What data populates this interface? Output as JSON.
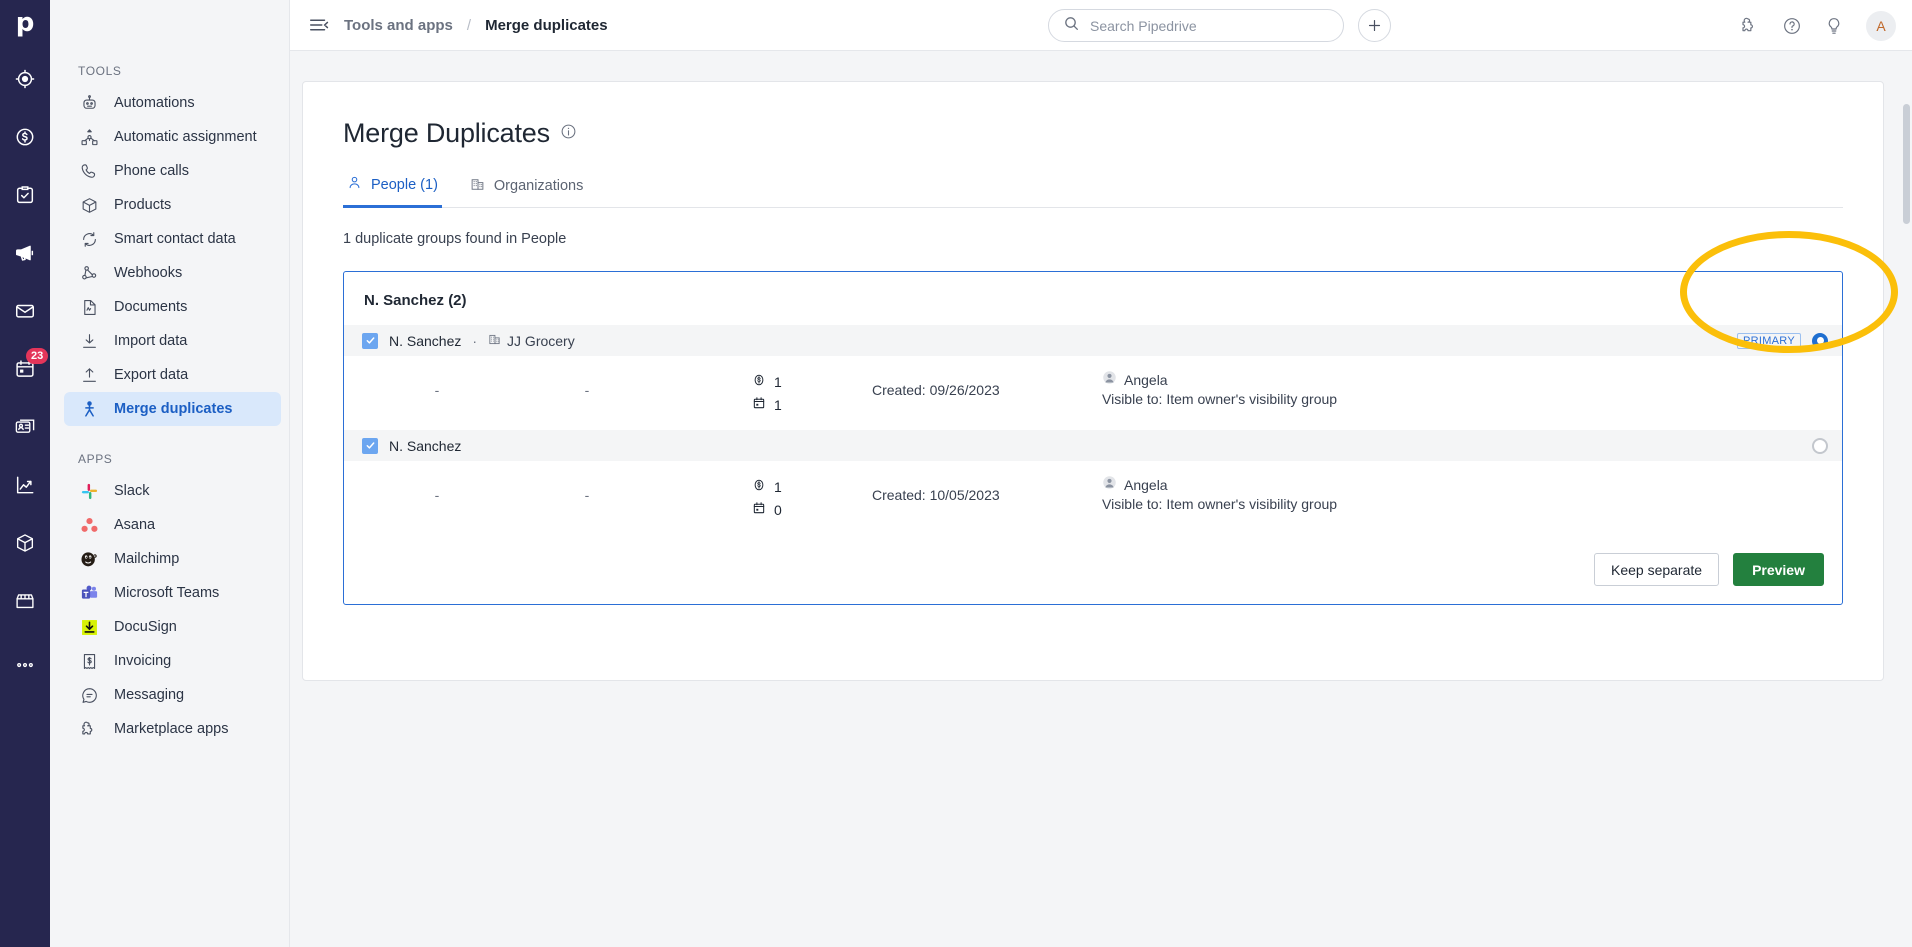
{
  "brand": {
    "logo_letter": "p",
    "accent": "#2b6fd6",
    "rail_bg": "#26264f",
    "highlight_color": "#fbbf0a"
  },
  "rail": {
    "items": [
      {
        "name": "leads-icon",
        "label": "Leads"
      },
      {
        "name": "deals-icon",
        "label": "Deals"
      },
      {
        "name": "activities-icon",
        "label": "Activities"
      },
      {
        "name": "campaigns-icon",
        "label": "Campaigns"
      },
      {
        "name": "mail-icon",
        "label": "Mail"
      },
      {
        "name": "calendar-icon",
        "label": "Calendar",
        "badge": "23"
      },
      {
        "name": "contacts-icon",
        "label": "Contacts"
      },
      {
        "name": "insights-icon",
        "label": "Insights"
      },
      {
        "name": "products-icon",
        "label": "Products"
      },
      {
        "name": "marketplace-icon",
        "label": "Marketplace"
      },
      {
        "name": "more-icon",
        "label": "More"
      }
    ]
  },
  "topbar": {
    "menu_icon": "hamburger-icon",
    "breadcrumb_parent": "Tools and apps",
    "breadcrumb_sep": "/",
    "breadcrumb_current": "Merge duplicates",
    "search_placeholder": "Search Pipedrive",
    "search_value": "",
    "add_label": "+",
    "icons": [
      {
        "name": "apps-puzzle-icon"
      },
      {
        "name": "help-icon"
      },
      {
        "name": "whats-new-bulb-icon"
      }
    ],
    "avatar_initial": "A"
  },
  "sidebar": {
    "tools_header": "TOOLS",
    "tools": [
      {
        "label": "Automations",
        "icon": "automations-icon"
      },
      {
        "label": "Automatic assignment",
        "icon": "automatic-assignment-icon"
      },
      {
        "label": "Phone calls",
        "icon": "phone-icon"
      },
      {
        "label": "Products",
        "icon": "products-box-icon"
      },
      {
        "label": "Smart contact data",
        "icon": "smart-contact-data-icon"
      },
      {
        "label": "Webhooks",
        "icon": "webhooks-icon"
      },
      {
        "label": "Documents",
        "icon": "documents-icon"
      },
      {
        "label": "Import data",
        "icon": "import-data-icon"
      },
      {
        "label": "Export data",
        "icon": "export-data-icon"
      },
      {
        "label": "Merge duplicates",
        "icon": "merge-duplicates-icon",
        "active": true
      }
    ],
    "apps_header": "APPS",
    "apps": [
      {
        "label": "Slack",
        "icon": "slack-icon"
      },
      {
        "label": "Asana",
        "icon": "asana-icon"
      },
      {
        "label": "Mailchimp",
        "icon": "mailchimp-icon"
      },
      {
        "label": "Microsoft Teams",
        "icon": "microsoft-teams-icon"
      },
      {
        "label": "DocuSign",
        "icon": "docusign-icon"
      },
      {
        "label": "Invoicing",
        "icon": "invoicing-icon"
      },
      {
        "label": "Messaging",
        "icon": "messaging-icon"
      },
      {
        "label": "Marketplace apps",
        "icon": "marketplace-apps-icon"
      }
    ]
  },
  "main": {
    "title": "Merge Duplicates",
    "info_icon": "info-icon",
    "tabs": [
      {
        "label": "People (1)",
        "icon": "person-icon",
        "active": true
      },
      {
        "label": "Organizations",
        "icon": "organization-icon",
        "active": false
      }
    ],
    "found_text": "1 duplicate groups found in People",
    "group": {
      "title": "N. Sanchez (2)",
      "rows": [
        {
          "name": "N. Sanchez",
          "separator": "·",
          "org": "JJ Grocery",
          "checked": true,
          "primary_badge": "PRIMARY",
          "selected": true,
          "col1": "-",
          "col2": "-",
          "deals_count": "1",
          "activities_count": "1",
          "created": "Created: 09/26/2023",
          "owner": "Angela",
          "visibility": "Visible to: Item owner's visibility group"
        },
        {
          "name": "N. Sanchez",
          "separator": "",
          "org": "",
          "checked": true,
          "primary_badge": "",
          "selected": false,
          "col1": "-",
          "col2": "-",
          "deals_count": "1",
          "activities_count": "0",
          "created": "Created: 10/05/2023",
          "owner": "Angela",
          "visibility": "Visible to: Item owner's visibility group"
        }
      ],
      "keep_separate_label": "Keep separate",
      "preview_label": "Preview"
    }
  }
}
